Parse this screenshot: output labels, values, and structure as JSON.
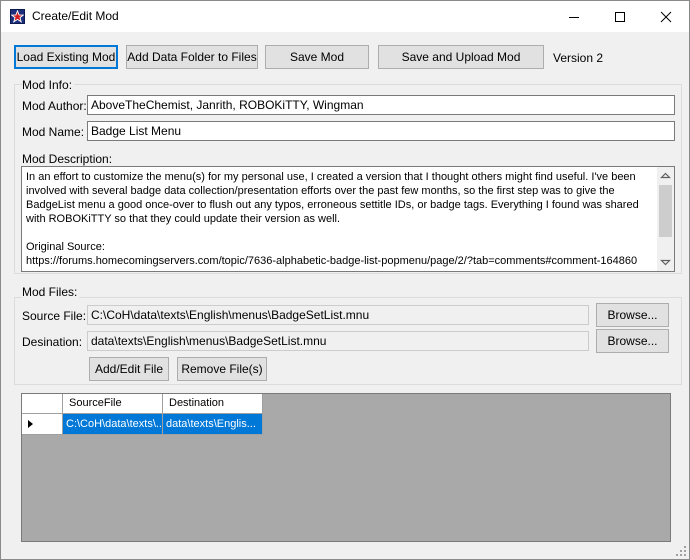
{
  "window": {
    "title": "Create/Edit Mod"
  },
  "toolbar": {
    "load_label": "Load Existing Mod",
    "add_folder_label": "Add Data Folder to Files",
    "save_label": "Save Mod",
    "save_upload_label": "Save and Upload Mod",
    "version_text": "Version 2"
  },
  "mod_info": {
    "group_label": "Mod Info:",
    "author_label": "Mod Author:",
    "author_value": "AboveTheChemist, Janrith, ROBOKiTTY, Wingman",
    "name_label": "Mod Name:",
    "name_value": "Badge List Menu",
    "description_label": "Mod Description:",
    "description_value": "In an effort to customize the menu(s) for my personal use, I created a version that I thought others might find useful. I've been involved with several badge data collection/presentation efforts over the past few months, so the first step was to give the BadgeList menu a good once-over to flush out any typos, erroneous settitle IDs, or badge tags. Everything I found was shared with ROBOKiTTY so that they could update their version as well.\n\nOriginal Source:\nhttps://forums.homecomingservers.com/topic/7636-alphabetic-badge-list-popmenu/page/2/?tab=comments#comment-164860"
  },
  "mod_files": {
    "group_label": "Mod Files:",
    "source_label": "Source File:",
    "source_value": "C:\\CoH\\data\\texts\\English\\menus\\BadgeSetList.mnu",
    "destination_label": "Desination:",
    "destination_value": "data\\texts\\English\\menus\\BadgeSetList.mnu",
    "browse_label": "Browse...",
    "add_edit_label": "Add/Edit File",
    "remove_label": "Remove File(s)"
  },
  "grid": {
    "columns": [
      "SourceFile",
      "Destination"
    ],
    "rows": [
      {
        "source": "C:\\CoH\\data\\texts\\...",
        "destination": "data\\texts\\Englis..."
      }
    ]
  }
}
